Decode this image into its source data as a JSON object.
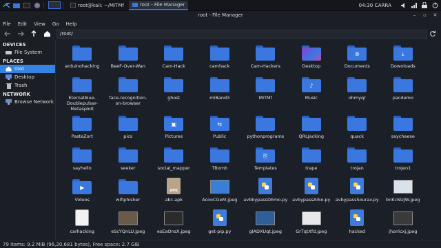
{
  "taskbar": {
    "windows": [
      {
        "label": "root@kali: ~/MITMf"
      },
      {
        "label": "root - File Manager"
      }
    ],
    "clock": "04:30 CARRA"
  },
  "window": {
    "title": "root - File Manager"
  },
  "menu": [
    "File",
    "Edit",
    "View",
    "Go",
    "Help"
  ],
  "path": "/root/",
  "sidebar": {
    "devices_header": "DEVICES",
    "devices": [
      {
        "label": "File System",
        "icon": "drive-icon"
      }
    ],
    "places_header": "PLACES",
    "places": [
      {
        "label": "root",
        "icon": "home-icon",
        "selected": true
      },
      {
        "label": "Desktop",
        "icon": "desktop-icon"
      },
      {
        "label": "Trash",
        "icon": "trash-icon"
      }
    ],
    "network_header": "NETWORK",
    "network": [
      {
        "label": "Browse Network",
        "icon": "network-icon"
      }
    ]
  },
  "files": [
    {
      "name": "arduinohacking",
      "kind": "folder"
    },
    {
      "name": "BeeF-Over-Wan",
      "kind": "folder"
    },
    {
      "name": "Cam-Hack",
      "kind": "folder"
    },
    {
      "name": "camhack",
      "kind": "folder"
    },
    {
      "name": "Cam-Hackers",
      "kind": "folder"
    },
    {
      "name": "Desktop",
      "kind": "desktop-folder"
    },
    {
      "name": "Documents",
      "kind": "folder",
      "glyph": "⊚"
    },
    {
      "name": "Downloads",
      "kind": "folder",
      "glyph": "⤓"
    },
    {
      "name": "Eternalblue-Doublepulsar-Metasploit",
      "kind": "folder"
    },
    {
      "name": "face-recognition-on-browser",
      "kind": "folder"
    },
    {
      "name": "ghost",
      "kind": "folder"
    },
    {
      "name": "miBand3",
      "kind": "folder"
    },
    {
      "name": "MITMf",
      "kind": "folder"
    },
    {
      "name": "Music",
      "kind": "folder",
      "glyph": "♪"
    },
    {
      "name": "ohmyqr",
      "kind": "folder"
    },
    {
      "name": "pacdemo",
      "kind": "folder"
    },
    {
      "name": "PasteZort",
      "kind": "folder"
    },
    {
      "name": "pics",
      "kind": "folder"
    },
    {
      "name": "Pictures",
      "kind": "folder",
      "glyph": "▣"
    },
    {
      "name": "Public",
      "kind": "folder",
      "glyph": "⇆"
    },
    {
      "name": "pythonprograms",
      "kind": "folder"
    },
    {
      "name": "QRLJacking",
      "kind": "folder"
    },
    {
      "name": "quack",
      "kind": "folder"
    },
    {
      "name": "saycheese",
      "kind": "folder"
    },
    {
      "name": "sayhello",
      "kind": "folder"
    },
    {
      "name": "seeker",
      "kind": "folder"
    },
    {
      "name": "social_mapper",
      "kind": "folder"
    },
    {
      "name": "TBomb",
      "kind": "folder"
    },
    {
      "name": "Templates",
      "kind": "folder",
      "glyph": "⎘"
    },
    {
      "name": "trape",
      "kind": "folder"
    },
    {
      "name": "trojan",
      "kind": "folder"
    },
    {
      "name": "trojen1",
      "kind": "folder"
    },
    {
      "name": "Videos",
      "kind": "folder",
      "glyph": "▶"
    },
    {
      "name": "wifiphisher",
      "kind": "folder"
    },
    {
      "name": "abc.apk",
      "kind": "apk"
    },
    {
      "name": "AcooCGeM.jpeg",
      "kind": "image",
      "thumb": "#3a7fd5"
    },
    {
      "name": "avbbypassDEmo.py",
      "kind": "python"
    },
    {
      "name": "avbypassArko.py",
      "kind": "python"
    },
    {
      "name": "avbypassSourav.py",
      "kind": "python"
    },
    {
      "name": "bnKcNUJW.jpeg",
      "kind": "image",
      "thumb": "#d9e1ea"
    },
    {
      "name": "carhacking",
      "kind": "doc"
    },
    {
      "name": "eScYQnLU.jpeg",
      "kind": "image",
      "thumb": "#6a5a4a"
    },
    {
      "name": "esEaOnsX.jpeg",
      "kind": "image",
      "thumb": "#2b2b2b"
    },
    {
      "name": "get-pip.py",
      "kind": "python"
    },
    {
      "name": "gIADXUqt.jpeg",
      "kind": "image",
      "thumb": "#2f5f9a"
    },
    {
      "name": "GrTqtXfd.jpeg",
      "kind": "image",
      "thumb": "#e8e8e8"
    },
    {
      "name": "hacked",
      "kind": "python"
    },
    {
      "name": "jhonlcxj.jpeg",
      "kind": "image",
      "thumb": "#3a3a3a"
    }
  ],
  "status": "79 items: 9.2 MiB (96,20,681 bytes), Free space: 2.7 GiB",
  "colors": {
    "folder": "#3a78e0",
    "folder_tab": "#2a61c4",
    "selection": "#3584e4",
    "background": "#1b1f27"
  }
}
